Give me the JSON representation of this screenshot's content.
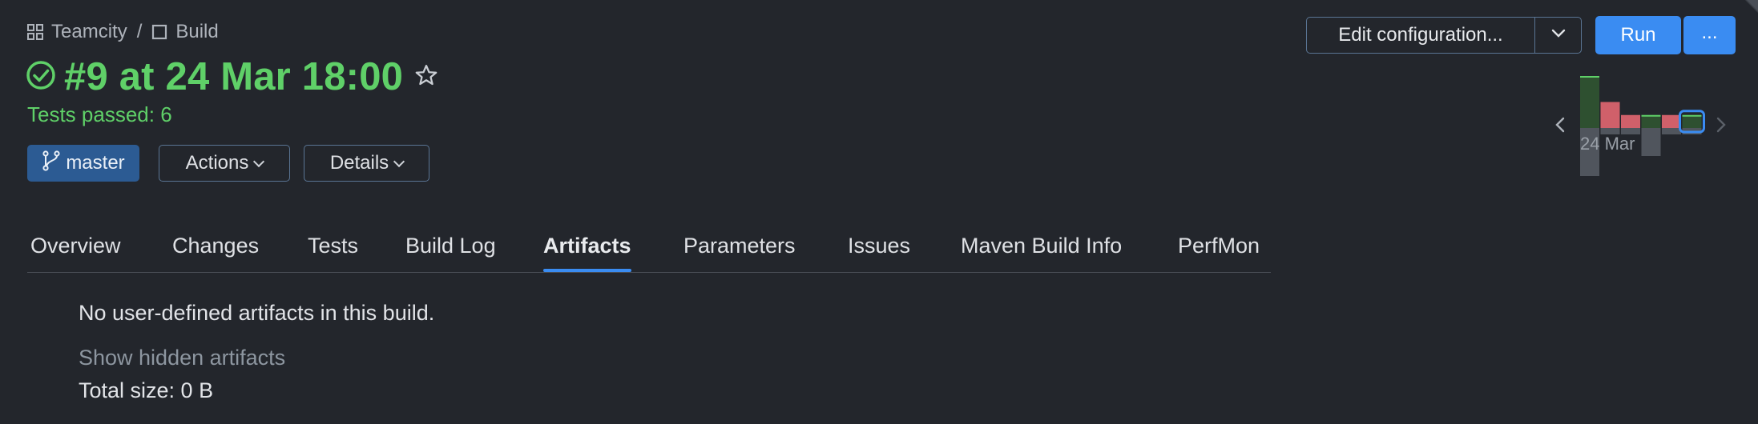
{
  "breadcrumb": {
    "project": "Teamcity",
    "separator": "/",
    "build_config": "Build"
  },
  "build": {
    "title": "#9 at 24 Mar 18:00",
    "tests_summary": "Tests passed: 6",
    "status": "success"
  },
  "toolbar": {
    "branch_label": "master",
    "actions_label": "Actions",
    "details_label": "Details",
    "edit_config_label": "Edit configuration...",
    "run_label": "Run",
    "more_label": "..."
  },
  "mini_history": {
    "date_label": "24 Mar",
    "builds": [
      {
        "status": "success",
        "duration_level": 1.0,
        "selected": false
      },
      {
        "status": "failed",
        "duration_level": 0.5,
        "selected": false
      },
      {
        "status": "failed",
        "duration_level": 0.25,
        "selected": false
      },
      {
        "status": "success",
        "duration_level": 0.25,
        "selected": false
      },
      {
        "status": "failed",
        "duration_level": 0.25,
        "selected": false
      },
      {
        "status": "success",
        "duration_level": 0.25,
        "selected": true
      }
    ]
  },
  "tabs": [
    {
      "label": "Overview",
      "active": false
    },
    {
      "label": "Changes",
      "active": false
    },
    {
      "label": "Tests",
      "active": false
    },
    {
      "label": "Build Log",
      "active": false
    },
    {
      "label": "Artifacts",
      "active": true
    },
    {
      "label": "Parameters",
      "active": false
    },
    {
      "label": "Issues",
      "active": false
    },
    {
      "label": "Maven Build Info",
      "active": false
    },
    {
      "label": "PerfMon",
      "active": false
    }
  ],
  "artifacts": {
    "empty_message": "No user-defined artifacts in this build.",
    "show_hidden_link": "Show hidden artifacts",
    "total_size": "Total size: 0 B"
  },
  "colors": {
    "success": "#5fd068",
    "accent": "#3a8cf2",
    "failed_bar": "#d0606a",
    "success_bar": "#2e5030",
    "background": "#23262c"
  }
}
